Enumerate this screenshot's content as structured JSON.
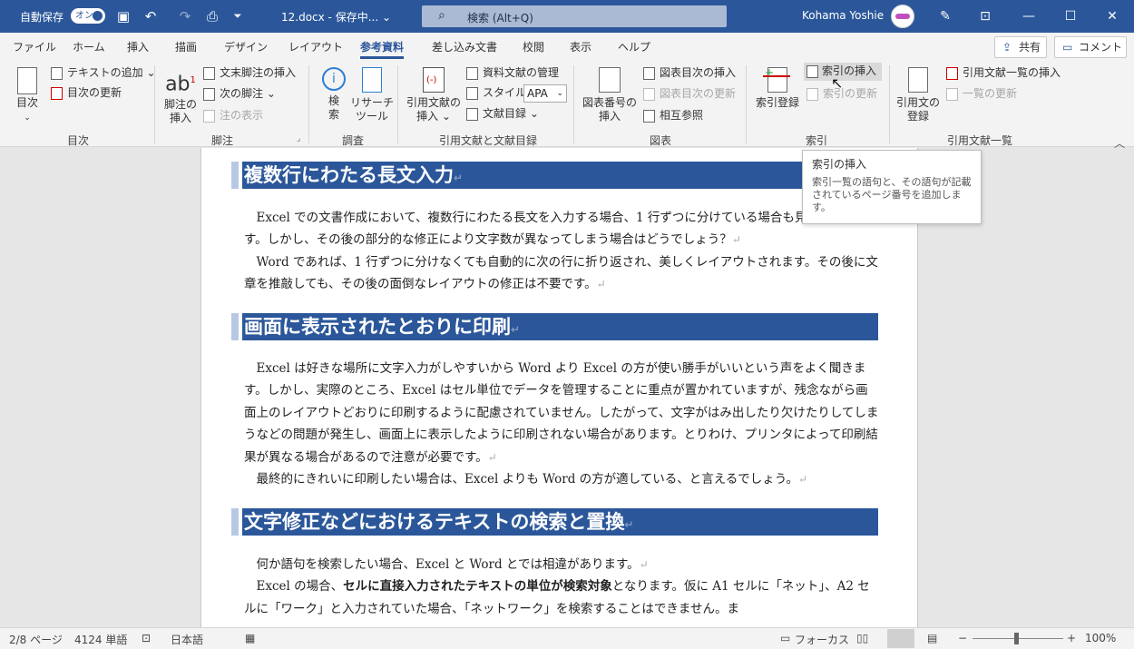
{
  "titlebar": {
    "autosave": "自動保存",
    "toggle": "オン",
    "doc_title": "12.docx - 保存中... ⌄",
    "search": "検索 (Alt+Q)",
    "user": "Kohama Yoshie"
  },
  "tabs": [
    "ファイル",
    "ホーム",
    "挿入",
    "描画",
    "デザイン",
    "レイアウト",
    "参考資料",
    "差し込み文書",
    "校閲",
    "表示",
    "ヘルプ"
  ],
  "share": "共有",
  "comment": "コメント",
  "ribbon": {
    "toc": {
      "big": "目次",
      "add_text": "テキストの追加 ⌄",
      "update": "目次の更新",
      "label": "目次"
    },
    "footnote": {
      "big1": "脚注の",
      "big2": "挿入",
      "endnote": "文末脚注の挿入",
      "next": "次の脚注 ⌄",
      "show": "注の表示",
      "label": "脚注"
    },
    "research": {
      "search1": "検",
      "search2": "索",
      "tool1": "リサーチ",
      "tool2": "ツール",
      "label": "調査"
    },
    "citation": {
      "big1": "引用文献の",
      "big2": "挿入 ⌄",
      "manage": "資料文献の管理",
      "style_label": "スタイル:",
      "style_value": "APA",
      "bib": "文献目録 ⌄",
      "label": "引用文献と文献目録"
    },
    "captions": {
      "big1": "図表番号の",
      "big2": "挿入",
      "insert_tof": "図表目次の挿入",
      "update_tof": "図表目次の更新",
      "cross": "相互参照",
      "label": "図表"
    },
    "index": {
      "mark": "索引登録",
      "insert": "索引の挿入",
      "update": "索引の更新",
      "label": "索引"
    },
    "toa": {
      "big1": "引用文の",
      "big2": "登録",
      "insert": "引用文献一覧の挿入",
      "update": "一覧の更新",
      "label": "引用文献一覧"
    }
  },
  "tooltip": {
    "title": "索引の挿入",
    "desc": "索引一覧の語句と、その語句が記載されているページ番号を追加します。"
  },
  "document": {
    "h1": "複数行にわたる長文入力",
    "p1a": "　Excel での文書作成において、複数行にわたる長文を入力する場合、1 行ずつに分けている場合も見受けられます。しかし、その後の部分的な修正により文字数が異なってしまう場合はどうでしょう？",
    "p1b": "　Word であれば、1 行ずつに分けなくても自動的に次の行に折り返され、美しくレイアウトされます。その後に文章を推敲しても、その後の面倒なレイアウトの修正は不要です。",
    "h2": "画面に表示されたとおりに印刷",
    "p2a": "　Excel は好きな場所に文字入力がしやすいから Word より Excel の方が使い勝手がいいという声をよく聞きます。しかし、実際のところ、Excel はセル単位でデータを管理することに重点が置かれていますが、残念ながら画面上のレイアウトどおりに印刷するように配慮されていません。したがって、文字がはみ出したり欠けたりしてしまうなどの問題が発生し、画面上に表示したように印刷されない場合があります。とりわけ、プリンタによって印刷結果が異なる場合があるので注意が必要です。",
    "p2b": "　最終的にきれいに印刷したい場合は、Excel よりも Word の方が適している、と言えるでしょう。",
    "h3": "文字修正などにおけるテキストの検索と置換",
    "p3a": "　何か語句を検索したい場合、Excel と Word とでは相違があります。",
    "p3b_pre": "　Excel の場合、",
    "p3b_bold": "セルに直接入力されたテキストの単位が検索対象",
    "p3b_post": "となります。仮に A1 セルに「ネット」、A2 セルに「ワーク」と入力されていた場合、「ネットワーク」を検索することはできません。ま"
  },
  "statusbar": {
    "page": "2/8 ページ",
    "words": "4124 単語",
    "lang": "日本語",
    "focus": "フォーカス",
    "zoom": "100%"
  },
  "colors": {
    "accent": "#2b579a",
    "heading_bg": "#2b579a"
  }
}
